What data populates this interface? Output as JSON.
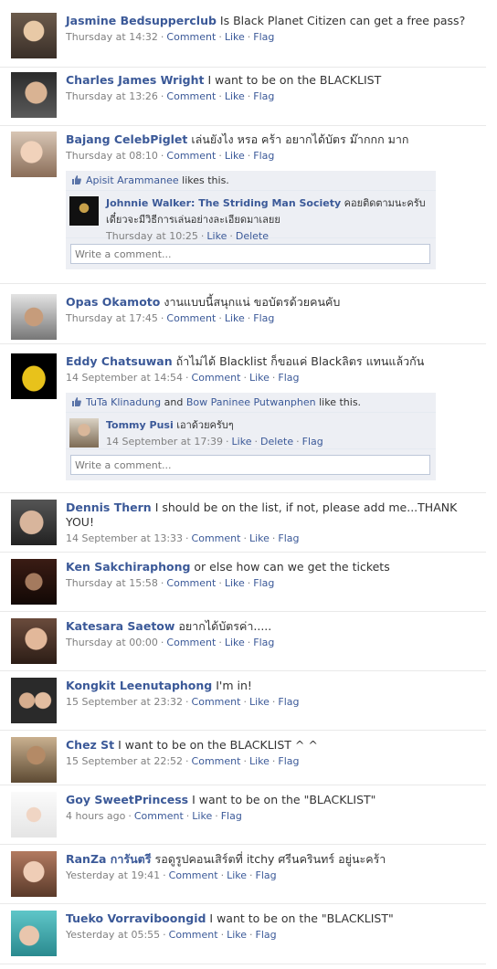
{
  "actions": {
    "comment": "Comment",
    "like": "Like",
    "flag": "Flag",
    "delete": "Delete",
    "comment_placeholder": "Write a comment..."
  },
  "posts": [
    {
      "name": "Jasmine Bedsupperclub",
      "message": "Is Black Planet Citizen can get a free pass?",
      "time": "Thursday at 14:32"
    },
    {
      "name": "Charles James Wright",
      "message": "I want to be on the BLACKLIST",
      "time": "Thursday at 13:26"
    },
    {
      "name": "Bajang CelebPiglet",
      "message": "เล่นยังไง หรอ คร้า อยากได้บัตร ม๊ากกก มาก",
      "time": "Thursday at 08:10",
      "likes": {
        "names": [
          "Apisit Arammanee"
        ],
        "suffix": " likes this."
      },
      "comment": {
        "name": "Johnnie Walker: The Striding Man Society",
        "text": "คอยติดตามนะครับเดี๋ยวจะมีวิธีการเล่นอย่างละเอียดมาเลยย",
        "time": "Thursday at 10:25",
        "actions": [
          "Like",
          "Delete"
        ]
      }
    },
    {
      "name": "Opas Okamoto",
      "message": "งานแบบนี้สนุกแน่ ขอบัตรด้วยคนคับ",
      "time": "Thursday at 17:45"
    },
    {
      "name": "Eddy Chatsuwan",
      "message": "ถ้าไม่ได้ Blacklist ก็ขอแค่ Blackลิตร แทนแล้วกัน",
      "time": "14 September at 14:54",
      "likes": {
        "names": [
          "TuTa Klinadung",
          "Bow Paninee Putwanphen"
        ],
        "joiner": " and ",
        "suffix": " like this."
      },
      "comment": {
        "name": "Tommy Pusi",
        "text": "เอาด้วยครับๆ",
        "time": "14 September at 17:39",
        "actions": [
          "Like",
          "Delete",
          "Flag"
        ]
      }
    },
    {
      "name": "Dennis Thern",
      "message": "I should be on the list, if not, please add me...THANK YOU!",
      "time": "14 September at 13:33"
    },
    {
      "name": "Ken Sakchiraphong",
      "message": "or else how can we get the tickets",
      "time": "Thursday at 15:58"
    },
    {
      "name": "Katesara Saetow",
      "message": "อยากได้บัตรค่า.....",
      "time": "Thursday at 00:00"
    },
    {
      "name": "Kongkit Leenutaphong",
      "message": "I'm in!",
      "time": "15 September at 23:32"
    },
    {
      "name": "Chez St",
      "message": "I want to be on the BLACKLIST ^ ^",
      "time": "15 September at 22:52"
    },
    {
      "name": "Goy SweetPrincess",
      "message": "I want to be on the \"BLACKLIST\"",
      "time": "4 hours ago"
    },
    {
      "name": "RanZa การันตรี",
      "message": "รอดูรูปคอนเสิร์ตที่ itchy ศรีนครินทร์ อยู่นะคร้า",
      "time": "Yesterday at 19:41"
    },
    {
      "name": "Tueko Vorraviboongid",
      "message": "I want to be on the \"BLACKLIST\"",
      "time": "Yesterday at 05:55"
    }
  ],
  "colors": {
    "link": "#3b5998",
    "meta": "#808080",
    "ufi_bg": "#edeff4"
  }
}
